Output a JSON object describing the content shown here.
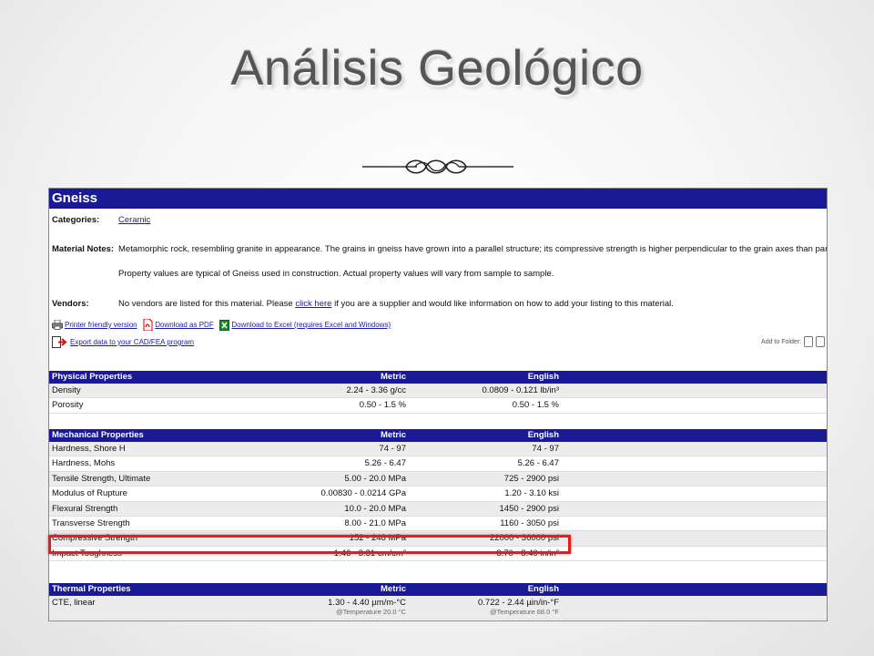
{
  "slide": {
    "title": "Análisis Geológico"
  },
  "page": {
    "material_name": "Gneiss",
    "categories_label": "Categories:",
    "categories_value": "Ceramic",
    "notes_label": "Material Notes:",
    "notes_line1": "Metamorphic rock, resembling granite in appearance. The grains in gneiss have grown into a parallel structure; its compressive strength is higher perpendicular to the grain axes than parallel to this axis.",
    "notes_line2": "Property values are typical of Gneiss used in construction. Actual property values will vary from sample to sample.",
    "vendors_label": "Vendors:",
    "vendors_pre": "No vendors are listed for this material. Please",
    "vendors_link": "click here",
    "vendors_post": "if you are a supplier and would like information on how to add your listing to this material.",
    "tools": {
      "printer": "Printer friendly version",
      "pdf": "Download as PDF",
      "excel": "Download to Excel (requires Excel and Windows)",
      "cad": "Export data to your CAD/FEA program"
    },
    "add_to_folder": "Add to Folder:"
  },
  "tables": {
    "physical": {
      "title": "Physical Properties",
      "metric": "Metric",
      "english": "English",
      "rows": [
        {
          "name": "Density",
          "metric": "2.24 - 3.36 g/cc",
          "english": "0.0809 - 0.121 lb/in³"
        },
        {
          "name": "Porosity",
          "metric": "0.50 - 1.5 %",
          "english": "0.50 - 1.5 %"
        }
      ]
    },
    "mechanical": {
      "title": "Mechanical Properties",
      "metric": "Metric",
      "english": "English",
      "rows": [
        {
          "name": "Hardness, Shore H",
          "metric": "74 - 97",
          "english": "74 - 97"
        },
        {
          "name": "Hardness, Mohs",
          "metric": "5.26 - 6.47",
          "english": "5.26 - 6.47"
        },
        {
          "name": "Tensile Strength, Ultimate",
          "metric": "5.00 - 20.0 MPa",
          "english": "725 - 2900 psi"
        },
        {
          "name": "Modulus of Rupture",
          "metric": "0.00830 - 0.0214 GPa",
          "english": "1.20 - 3.10 ksi"
        },
        {
          "name": "Flexural Strength",
          "metric": "10.0 - 20.0 MPa",
          "english": "1450 - 2900 psi"
        },
        {
          "name": "Transverse Strength",
          "metric": "8.00 - 21.0 MPa",
          "english": "1160 - 3050 psi"
        },
        {
          "name": "Compressive Strength",
          "metric": "152 - 248 MPa",
          "english": "22000 - 36000 psi"
        },
        {
          "name": "Impact Toughness",
          "metric": "1.46 - 3.31 cm/cm²",
          "english": "3.70 - 8.40 in/in²"
        }
      ]
    },
    "thermal": {
      "title": "Thermal Properties",
      "metric": "Metric",
      "english": "English",
      "rows": [
        {
          "name": "CTE, linear",
          "metric": "1.30 - 4.40 µm/m-°C",
          "english": "0.722 - 2.44 µin/in-°F",
          "metric_note": "@Temperature 20.0 °C",
          "english_note": "@Temperature 68.0 °F"
        }
      ]
    }
  },
  "colors": {
    "header_blue": "#1a1a96",
    "highlight_red": "#e31e1e",
    "link_blue": "#1a1aa8"
  }
}
